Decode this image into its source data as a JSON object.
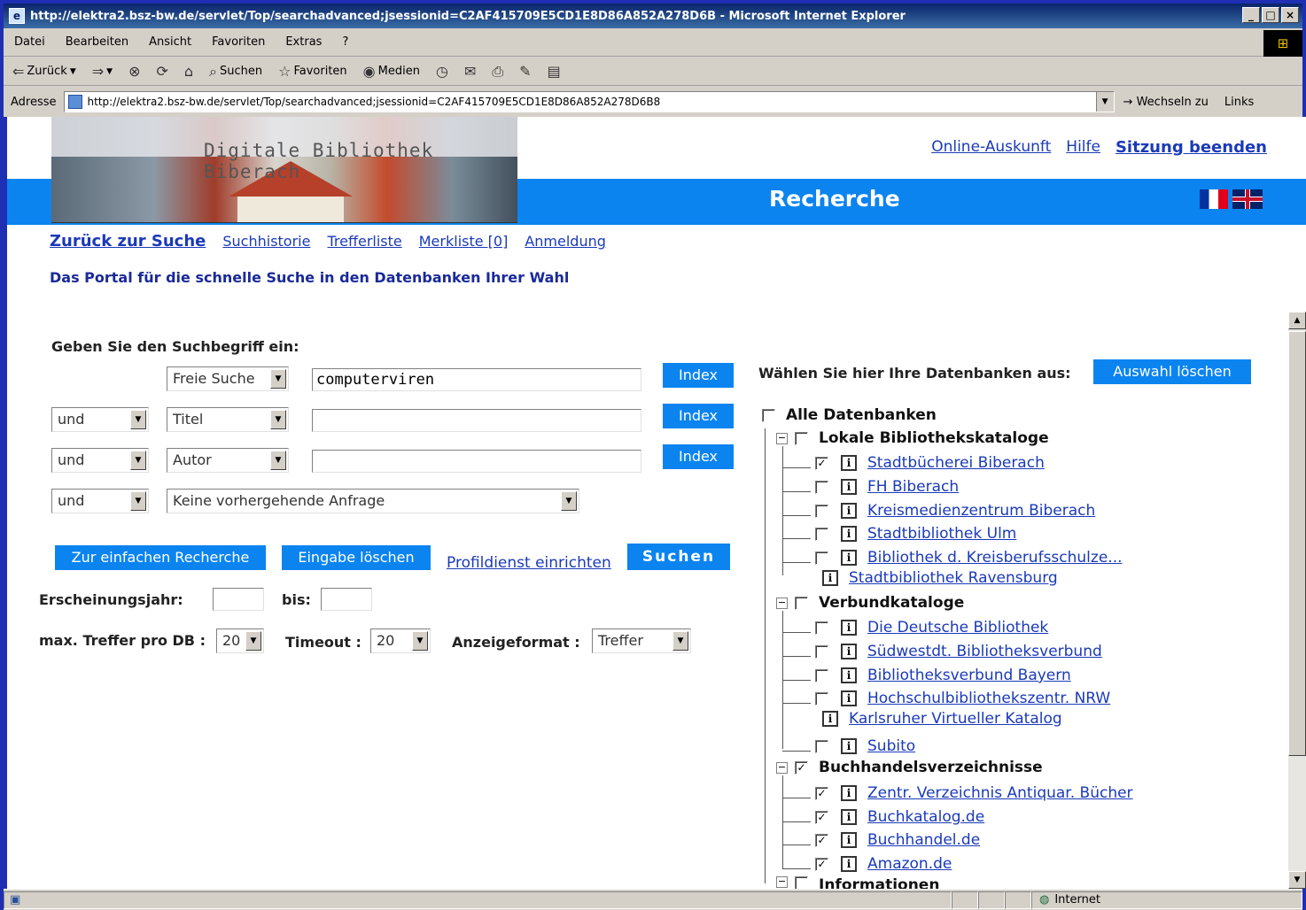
{
  "window": {
    "title": "http://elektra2.bsz-bw.de/servlet/Top/searchadvanced;jsessionid=C2AF415709E5CD1E8D86A852A278D6B - Microsoft Internet Explorer",
    "minimize": "_",
    "maximize": "□",
    "close": "×"
  },
  "menu": [
    "Datei",
    "Bearbeiten",
    "Ansicht",
    "Favoriten",
    "Extras",
    "?"
  ],
  "toolbar": {
    "back": "Zurück",
    "search": "Suchen",
    "favorites": "Favoriten",
    "media": "Medien"
  },
  "address": {
    "label": "Adresse",
    "url": "http://elektra2.bsz-bw.de/servlet/Top/searchadvanced;jsessionid=C2AF415709E5CD1E8D86A852A278D6B8",
    "go": "Wechseln zu",
    "links": "Links"
  },
  "header": {
    "banner_title": "Digitale Bibliothek Biberach",
    "section_title": "Recherche",
    "links": {
      "online": "Online-Auskunft",
      "help": "Hilfe",
      "logout": "Sitzung beenden"
    }
  },
  "nav": {
    "back": "Zurück zur Suche",
    "history": "Suchhistorie",
    "results": "Trefferliste",
    "bookmarks": "Merkliste [0]",
    "login": "Anmeldung"
  },
  "portal_text": "Das Portal für die schnelle Suche in den Datenbanken Ihrer Wahl",
  "search": {
    "label": "Geben Sie den Suchbegriff ein:",
    "rows": [
      {
        "op": "",
        "field": "Freie Suche",
        "value": "computerviren",
        "button": "Index"
      },
      {
        "op": "und",
        "field": "Titel",
        "value": "",
        "button": "Index"
      },
      {
        "op": "und",
        "field": "Autor",
        "value": "",
        "button": "Index"
      }
    ],
    "prev_op": "und",
    "prev_query": "Keine vorhergehende Anfrage",
    "btn_simple": "Zur einfachen Recherche",
    "btn_clear": "Eingabe löschen",
    "link_profile": "Profildienst einrichten",
    "btn_search": "Suchen",
    "year_label": "Erscheinungsjahr:",
    "to_label": "bis:",
    "max_label": "max. Treffer pro DB :",
    "max_value": "20",
    "timeout_label": "Timeout :",
    "timeout_value": "20",
    "format_label": "Anzeigeformat :",
    "format_value": "Treffer"
  },
  "databases": {
    "label": "Wählen Sie hier Ihre Datenbanken aus:",
    "clear_button": "Auswahl löschen",
    "all": "Alle Datenbanken",
    "groups": [
      {
        "name": "Lokale Bibliothekskataloge",
        "items": [
          "Stadtbücherei Biberach",
          "FH Biberach",
          "Kreismedienzentrum Biberach",
          "Stadtbibliothek Ulm",
          "Bibliothek d. Kreisberufsschulze...",
          "Stadtbibliothek Ravensburg"
        ]
      },
      {
        "name": "Verbundkataloge",
        "items": [
          "Die Deutsche Bibliothek",
          "Südwestdt. Bibliotheksverbund",
          "Bibliotheksverbund Bayern",
          "Hochschulbibliothekszentr. NRW",
          "Karlsruher Virtueller Katalog",
          "Subito"
        ]
      },
      {
        "name": "Buchhandelsverzeichnisse",
        "items": [
          "Zentr. Verzeichnis Antiquar. Bücher",
          "Buchkatalog.de",
          "Buchhandel.de",
          "Amazon.de"
        ]
      },
      {
        "name": "Informationen"
      }
    ]
  },
  "status": {
    "zone": "Internet"
  }
}
